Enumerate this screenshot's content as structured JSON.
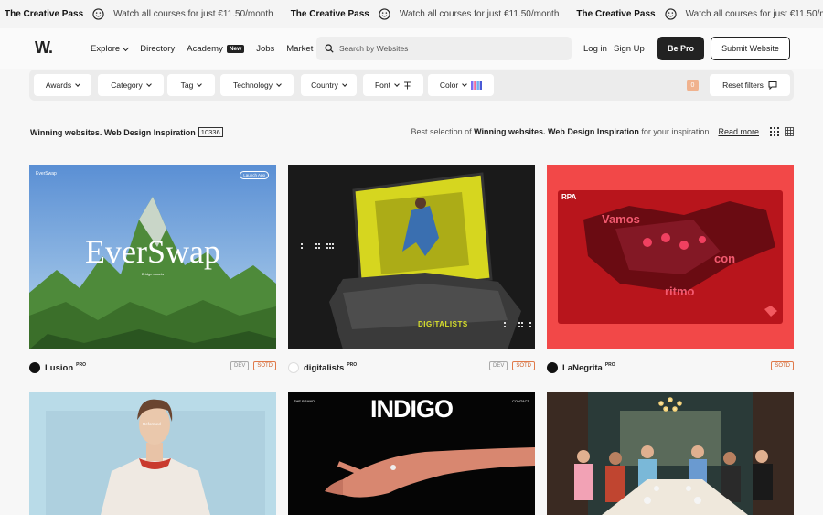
{
  "marquee": {
    "title": "The Creative Pass",
    "text": "Watch all courses for just €11.50/month"
  },
  "nav": {
    "logo": "W.",
    "links": [
      {
        "label": "Explore",
        "dropdown": true
      },
      {
        "label": "Directory"
      },
      {
        "label": "Academy",
        "badge": "New"
      },
      {
        "label": "Jobs"
      },
      {
        "label": "Market"
      }
    ],
    "search_placeholder": "Search by Websites",
    "login": "Log in",
    "signup": "Sign Up",
    "be_pro": "Be Pro",
    "submit": "Submit Website"
  },
  "filters": {
    "chips": [
      "Awards",
      "Category",
      "Tag",
      "Technology",
      "Country",
      "Font",
      "Color"
    ],
    "count": "0",
    "reset": "Reset filters"
  },
  "section": {
    "title": "Winning websites. Web Design Inspiration",
    "count": "10336",
    "desc_prefix": "Best selection of",
    "desc_bold": "Winning websites. Web Design Inspiration",
    "desc_suffix": "for your inspiration...",
    "read_more": "Read more"
  },
  "cards": [
    {
      "name": "Lusion",
      "pro": "PRO",
      "tags": [
        "DEV",
        "SOTD"
      ],
      "thumb": {
        "brand": "EverSwap",
        "title": "EverSwap",
        "sub": "Bridge assets",
        "cta": "Launch App"
      }
    },
    {
      "name": "digitalists",
      "pro": "PRO",
      "tags": [
        "DEV",
        "SOTD"
      ],
      "thumb": {
        "brand": "DIGITALISTS"
      }
    },
    {
      "name": "LaNegrita",
      "pro": "PRO",
      "tags": [
        "SOTD"
      ],
      "thumb": {
        "logo": "RPA",
        "words": [
          "Vamos",
          "con",
          "ritmo"
        ]
      }
    },
    {
      "thumb": {
        "brand": "Reformed"
      }
    },
    {
      "thumb": {
        "title": "INDIGO",
        "left": "THE BRAND",
        "right": "CONTACT"
      }
    },
    {
      "thumb": {}
    }
  ],
  "colors": {
    "accent": "#f0b28e",
    "sotd": "#e07a4a",
    "dark": "#222222"
  }
}
